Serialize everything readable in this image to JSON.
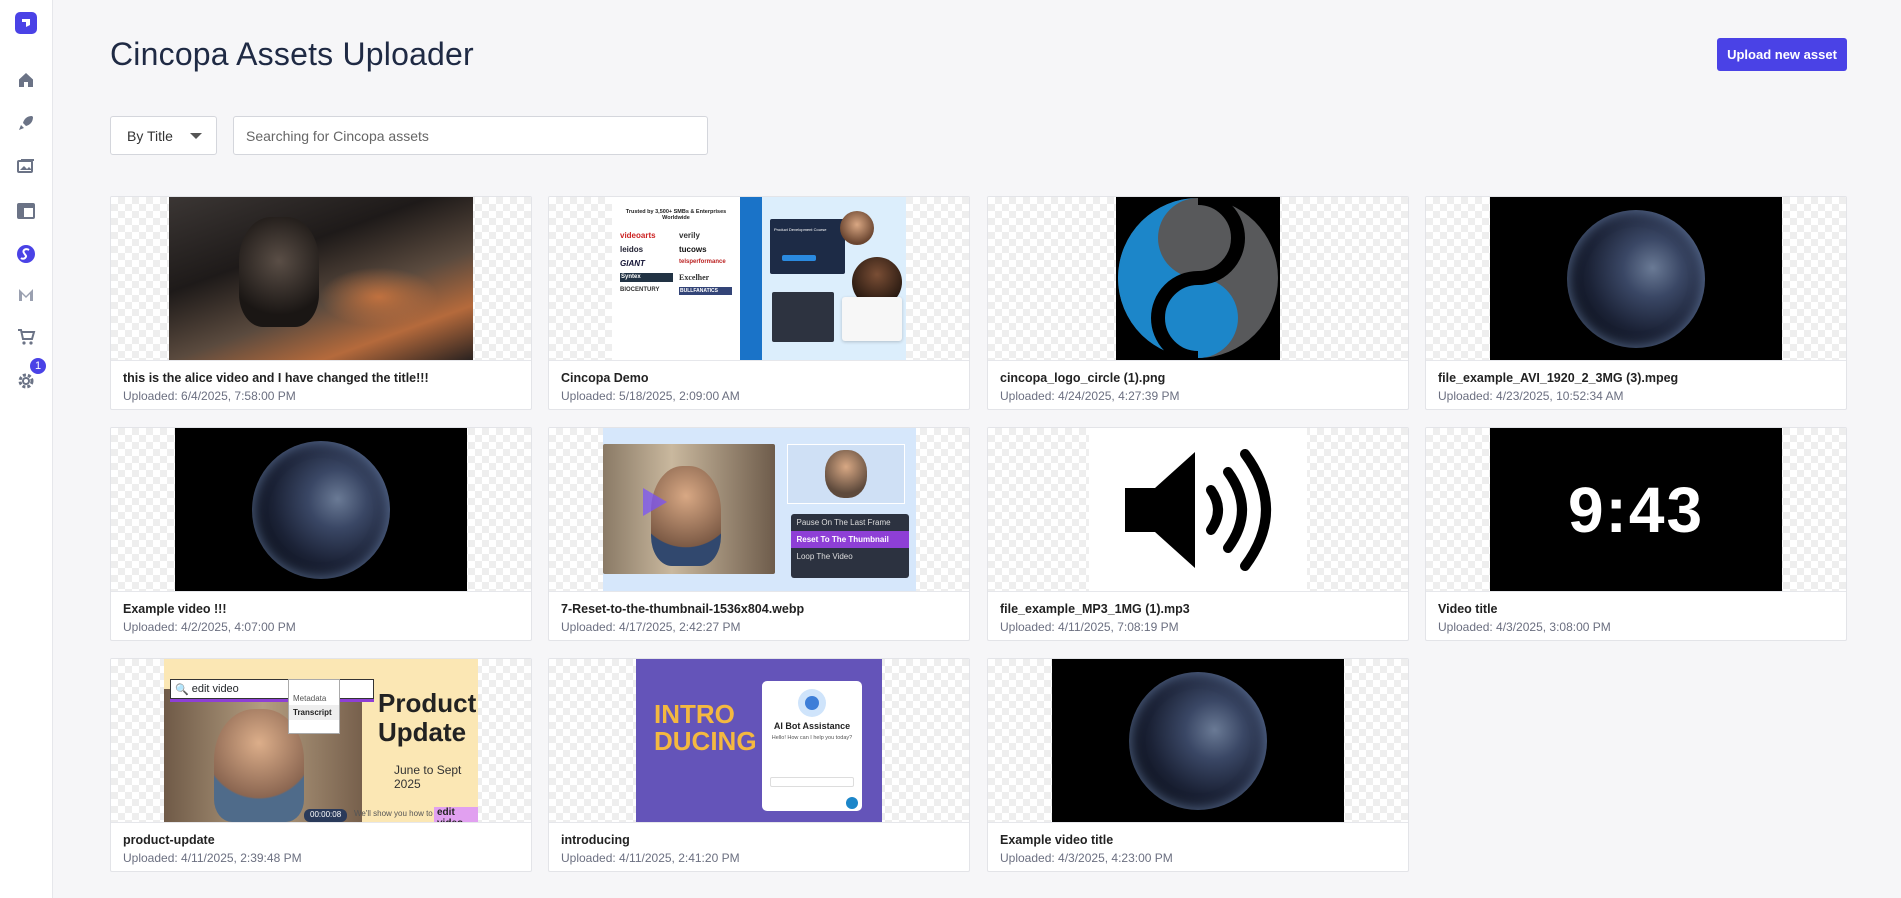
{
  "app": {
    "title": "Cincopa Assets Uploader",
    "upload_label": "Upload new asset"
  },
  "sidebar": {
    "badge_count": "1",
    "items": [
      "home-icon",
      "rocket-icon",
      "gallery-icon",
      "layout-icon",
      "cincopa-icon",
      "m-icon",
      "cart-icon",
      "gear-icon"
    ]
  },
  "filter": {
    "selected": "By Title"
  },
  "search": {
    "placeholder": "Searching for Cincopa assets",
    "value": ""
  },
  "assets": [
    {
      "title": "this is the alice video and I have changed the title!!!",
      "date": "Uploaded: 6/4/2025, 7:58:00 PM"
    },
    {
      "title": "Cincopa Demo",
      "date": "Uploaded: 5/18/2025, 2:09:00 AM"
    },
    {
      "title": "cincopa_logo_circle (1).png",
      "date": "Uploaded: 4/24/2025, 4:27:39 PM"
    },
    {
      "title": "file_example_AVI_1920_2_3MG (3).mpeg",
      "date": "Uploaded: 4/23/2025, 10:52:34 AM"
    },
    {
      "title": "Example video !!!",
      "date": "Uploaded: 4/2/2025, 4:07:00 PM"
    },
    {
      "title": "7-Reset-to-the-thumbnail-1536x804.webp",
      "date": "Uploaded: 4/17/2025, 2:42:27 PM"
    },
    {
      "title": "file_example_MP3_1MG (1).mp3",
      "date": "Uploaded: 4/11/2025, 7:08:19 PM"
    },
    {
      "title": "Video title",
      "date": "Uploaded: 4/3/2025, 3:08:00 PM"
    },
    {
      "title": "product-update",
      "date": "Uploaded: 4/11/2025, 2:39:48 PM"
    },
    {
      "title": "introducing",
      "date": "Uploaded: 4/11/2025, 2:41:20 PM"
    },
    {
      "title": "Example video title",
      "date": "Uploaded: 4/3/2025, 4:23:00 PM"
    }
  ],
  "thumb_text": {
    "demo_trusted": "Trusted by 3,500+ SMBs & Enterprises Worldwide",
    "demo_logos": [
      "videoarts",
      "verily",
      "leidos",
      "tucows",
      "GIANT",
      "telsperformance",
      "Syntex",
      "Excelher",
      "BIOCENTURY",
      "BULLFANATICS"
    ],
    "demo_heading": "Product Development Course",
    "reset_menu": [
      "Pause On The Last Frame",
      "Reset To The Thumbnail",
      "Loop The Video"
    ],
    "clock": "9:43",
    "pu_search": "edit video",
    "pu_menu": [
      "Metadata",
      "Transcript"
    ],
    "pu_heading": "Product Update",
    "pu_sub": "June to Sept 2025",
    "pu_time": "00:00:08",
    "pu_caption": "We'll show you how to",
    "pu_highlight": "edit video",
    "intro_text": "INTRO DUCING",
    "intro_bot_title": "AI Bot Assistance",
    "intro_bot_msg": "Hello! How can I help you today?"
  }
}
